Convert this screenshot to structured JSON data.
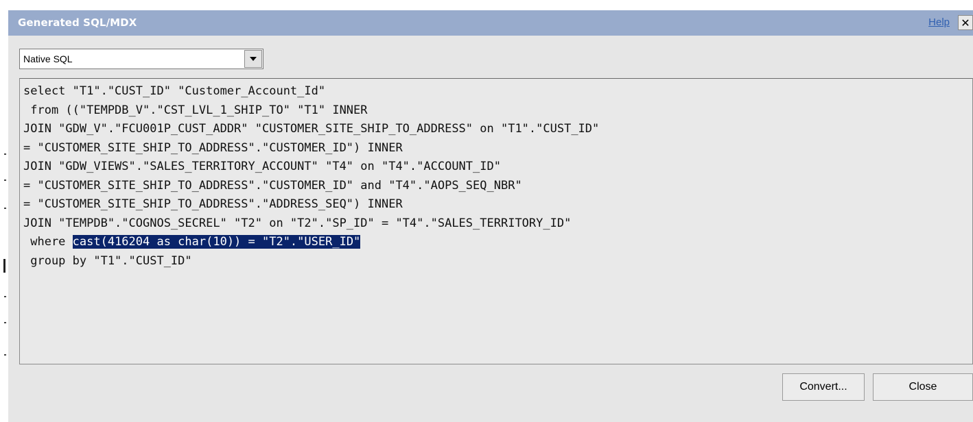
{
  "dialog": {
    "title": "Generated SQL/MDX",
    "help_label": "Help",
    "close_glyph": "✕",
    "close_icon": "close-icon"
  },
  "sql_type_select": {
    "value": "Native SQL",
    "icon": "chevron-down-icon"
  },
  "sql": {
    "lines": [
      {
        "before": "select \"T1\".\"CUST_ID\" \"Customer_Account_Id\"",
        "highlight": "",
        "after": ""
      },
      {
        "before": " from ((\"TEMPDB_V\".\"CST_LVL_1_SHIP_TO\" \"T1\" INNER",
        "highlight": "",
        "after": ""
      },
      {
        "before": "JOIN \"GDW_V\".\"FCU001P_CUST_ADDR\" \"CUSTOMER_SITE_SHIP_TO_ADDRESS\" on \"T1\".\"CUST_ID\"",
        "highlight": "",
        "after": ""
      },
      {
        "before": "= \"CUSTOMER_SITE_SHIP_TO_ADDRESS\".\"CUSTOMER_ID\") INNER",
        "highlight": "",
        "after": ""
      },
      {
        "before": "JOIN \"GDW_VIEWS\".\"SALES_TERRITORY_ACCOUNT\" \"T4\" on \"T4\".\"ACCOUNT_ID\"",
        "highlight": "",
        "after": ""
      },
      {
        "before": "= \"CUSTOMER_SITE_SHIP_TO_ADDRESS\".\"CUSTOMER_ID\" and \"T4\".\"AOPS_SEQ_NBR\"",
        "highlight": "",
        "after": ""
      },
      {
        "before": "= \"CUSTOMER_SITE_SHIP_TO_ADDRESS\".\"ADDRESS_SEQ\") INNER",
        "highlight": "",
        "after": ""
      },
      {
        "before": "JOIN \"TEMPDB\".\"COGNOS_SECREL\" \"T2\" on \"T2\".\"SP_ID\" = \"T4\".\"SALES_TERRITORY_ID\"",
        "highlight": "",
        "after": ""
      },
      {
        "before": " where ",
        "highlight": "cast(416204 as char(10)) = \"T2\".\"USER_ID\"",
        "after": ""
      },
      {
        "before": " group by \"T1\".\"CUST_ID\"",
        "highlight": "",
        "after": ""
      }
    ]
  },
  "buttons": {
    "convert_label": "Convert...",
    "close_label": "Close"
  },
  "colors": {
    "title_bar": "#98abcc",
    "selection": "#0a246a",
    "help_link": "#2f5fb0"
  }
}
